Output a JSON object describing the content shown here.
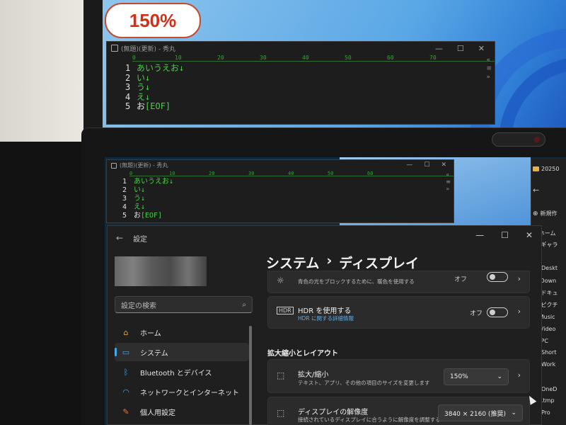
{
  "badge": {
    "zoom": "150%"
  },
  "editor": {
    "title": "(無題)(更新) - 秀丸",
    "ruler": [
      "0",
      "10",
      "20",
      "30",
      "40",
      "50",
      "60",
      "70"
    ],
    "lines": [
      {
        "num": "1",
        "text": "あいうえお↓"
      },
      {
        "num": "2",
        "text": "い↓"
      },
      {
        "num": "3",
        "text": "う↓"
      },
      {
        "num": "4",
        "text": "え↓"
      },
      {
        "num": "5",
        "text": "お"
      }
    ],
    "eof": "[EOF]"
  },
  "settings": {
    "title": "設定",
    "search_placeholder": "設定の検索",
    "nav": [
      "ホーム",
      "システム",
      "Bluetooth とデバイス",
      "ネットワークとインターネット",
      "個人用設定"
    ],
    "breadcrumb": [
      "システム",
      "ディスプレイ"
    ],
    "night_light": {
      "sub": "青色の光をブロックするために、暖色を使用する",
      "state": "オフ"
    },
    "hdr": {
      "title": "HDR を使用する",
      "link": "HDR に関する詳細情報",
      "state": "オフ"
    },
    "section": "拡大縮小とレイアウト",
    "scale": {
      "title": "拡大/縮小",
      "sub": "テキスト、アプリ、その他の項目のサイズを変更します",
      "value": "150%"
    },
    "resolution": {
      "title": "ディスプレイの解像度",
      "sub": "接続されているディスプレイに合うように解像度を調整する",
      "value": "3840 × 2160 (推奨)"
    }
  },
  "explorer": {
    "tab": "20250",
    "new": "新規作",
    "items": [
      "ホーム",
      "ギャラ",
      "Deskt",
      "Down",
      "ドキュ",
      "ピクチ",
      "Music",
      "Video",
      "PC",
      "Short",
      "Work",
      "OneD",
      ".tmp",
      "Pro"
    ]
  }
}
